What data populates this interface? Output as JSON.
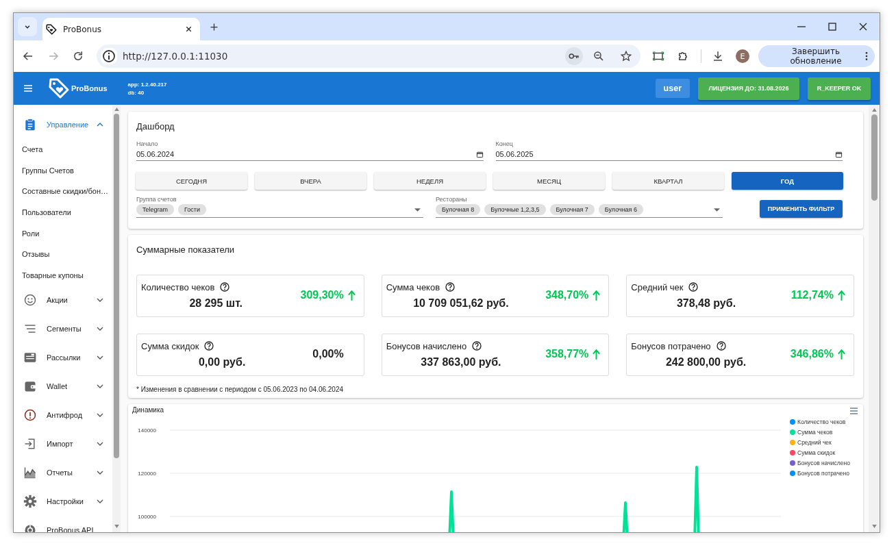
{
  "browser": {
    "tab_title": "ProBonus",
    "url": "http://127.0.0.1:11030",
    "forward_disabled": true,
    "profile_initial": "E",
    "update_button": "Завершить обновление"
  },
  "app_bar": {
    "logo": "ProBonus",
    "app_version": "app: 1.2.40.217",
    "db_version": "db: 40",
    "user": "user",
    "license": "ЛИЦЕНЗИЯ ДО: 31.08.2026",
    "rkeeper": "R_KEEPER OK"
  },
  "sidebar": {
    "items": [
      {
        "label": "Управление",
        "kind": "group",
        "expanded": true,
        "children": [
          {
            "label": "Счета"
          },
          {
            "label": "Группы Счетов"
          },
          {
            "label": "Составные скидки/бон…"
          },
          {
            "label": "Пользователи"
          },
          {
            "label": "Роли"
          },
          {
            "label": "Отзывы"
          },
          {
            "label": "Товарные купоны"
          }
        ]
      },
      {
        "label": "Акции",
        "kind": "group",
        "expanded": false
      },
      {
        "label": "Сегменты",
        "kind": "group",
        "expanded": false
      },
      {
        "label": "Рассылки",
        "kind": "group",
        "expanded": false
      },
      {
        "label": "Wallet",
        "kind": "group",
        "expanded": false
      },
      {
        "label": "Антифрод",
        "kind": "group",
        "expanded": false
      },
      {
        "label": "Импорт",
        "kind": "group",
        "expanded": false
      },
      {
        "label": "Отчеты",
        "kind": "group",
        "expanded": false
      },
      {
        "label": "Настройки",
        "kind": "group",
        "expanded": false
      },
      {
        "label": "ProBonus API",
        "kind": "link"
      }
    ]
  },
  "dashboard": {
    "title": "Дашборд",
    "start": {
      "label": "Начало",
      "value": "05.06.2024"
    },
    "end": {
      "label": "Конец",
      "value": "05.06.2025"
    },
    "periods": [
      {
        "label": "СЕГОДНЯ",
        "selected": false
      },
      {
        "label": "ВЧЕРА",
        "selected": false
      },
      {
        "label": "НЕДЕЛЯ",
        "selected": false
      },
      {
        "label": "МЕСЯЦ",
        "selected": false
      },
      {
        "label": "КВАРТАЛ",
        "selected": false
      },
      {
        "label": "ГОД",
        "selected": true
      }
    ],
    "account_groups": {
      "label": "Группа счетов",
      "chips": [
        "Telegram",
        "Гости"
      ]
    },
    "restaurants": {
      "label": "Рестораны",
      "chips": [
        "Булочная 8",
        "Булочные 1,2,3,5",
        "Булочная 7",
        "Булочная 6"
      ]
    },
    "apply_button": "ПРИМЕНИТЬ ФИЛЬТР"
  },
  "summary": {
    "title": "Суммарные показатели",
    "cards": [
      {
        "label": "Количество чеков",
        "value": "28 295 шт.",
        "change": "309,30%",
        "rising": true
      },
      {
        "label": "Сумма чеков",
        "value": "10 709 051,62 руб.",
        "change": "348,70%",
        "rising": true
      },
      {
        "label": "Средний чек",
        "value": "378,48 руб.",
        "change": "112,74%",
        "rising": true
      },
      {
        "label": "Сумма скидок",
        "value": "0,00 руб.",
        "change": "0,00%",
        "rising": false
      },
      {
        "label": "Бонусов начислено",
        "value": "337 863,00 руб.",
        "change": "358,77%",
        "rising": true
      },
      {
        "label": "Бонусов потрачено",
        "value": "242 800,00 руб.",
        "change": "346,86%",
        "rising": true
      }
    ],
    "footnote": "* Изменения в сравнении с периодом с 05.06.2023 по 04.06.2024"
  },
  "dynamics": {
    "title": "Динамика",
    "y_labels": [
      "140000",
      "120000",
      "100000"
    ],
    "legend": [
      {
        "name": "Количество чеков",
        "color": "#008ffb"
      },
      {
        "name": "Сумма чеков",
        "color": "#00e396"
      },
      {
        "name": "Средний чек",
        "color": "#feb019"
      },
      {
        "name": "Сумма скидок",
        "color": "#ff4560"
      },
      {
        "name": "Бонусов начислено",
        "color": "#775dd0"
      },
      {
        "name": "Бонусов потрачено",
        "color": "#008ffb"
      }
    ]
  }
}
